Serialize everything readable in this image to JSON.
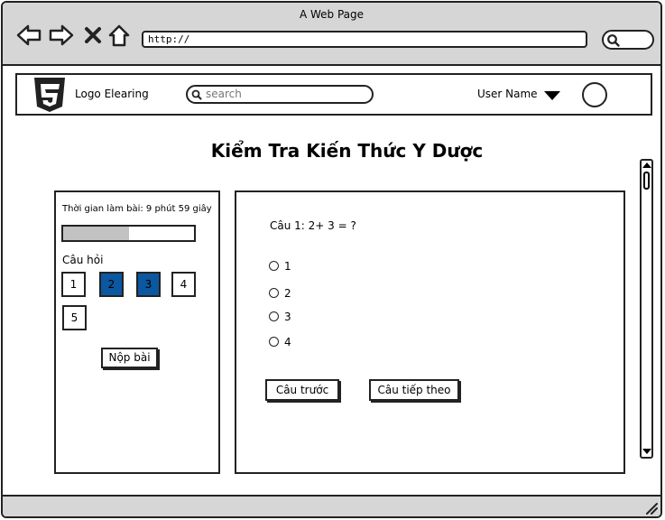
{
  "browser": {
    "window_title": "A Web Page",
    "url": "http://",
    "icons": [
      "back-icon",
      "forward-icon",
      "close-icon",
      "home-icon",
      "search-icon"
    ]
  },
  "header": {
    "logo_text": "Logo Elearing",
    "search_placeholder": "search",
    "user_name": "User Name"
  },
  "page": {
    "title": "Kiểm Tra Kiến Thức Y Dược"
  },
  "left_panel": {
    "time_label": "Thời gian làm bài: 9 phút 59 giây",
    "time_progress_fraction": 0.5,
    "questions_label": "Câu hỏi",
    "question_buttons": [
      {
        "label": "1",
        "state": "default"
      },
      {
        "label": "2",
        "state": "active"
      },
      {
        "label": "3",
        "state": "active"
      },
      {
        "label": "4",
        "state": "default"
      },
      {
        "label": "5",
        "state": "default"
      }
    ],
    "submit_label": "Nộp bài"
  },
  "question_panel": {
    "question": "Câu 1: 2+ 3 = ?",
    "options": [
      "1",
      "2",
      "3",
      "4"
    ],
    "prev_label": "Câu trước",
    "next_label": "Câu tiếp theo"
  },
  "colors": {
    "active_question": "#0b57a0",
    "chrome_gray": "#d6d6d6",
    "progress_fill": "#c2c2c2"
  }
}
